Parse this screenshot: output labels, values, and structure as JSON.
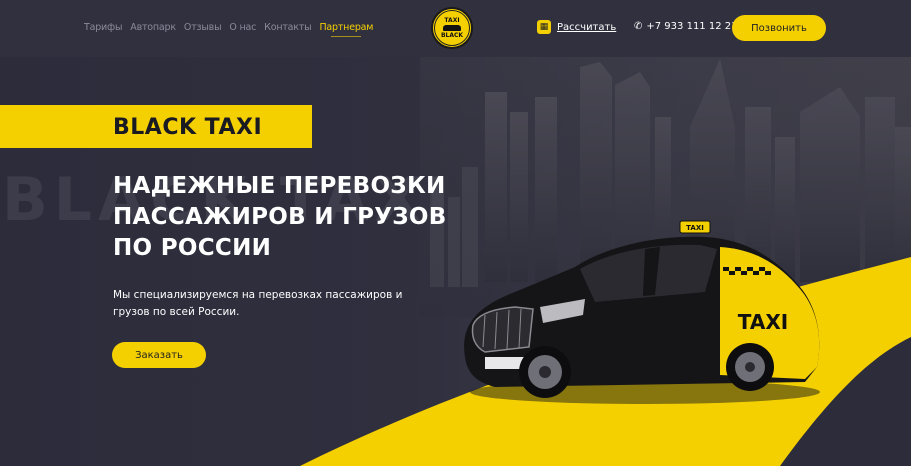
{
  "header": {
    "nav": [
      {
        "label": "Тарифы",
        "active": false
      },
      {
        "label": "Автопарк",
        "active": false
      },
      {
        "label": "Отзывы",
        "active": false
      },
      {
        "label": "О нас",
        "active": false
      },
      {
        "label": "Контакты",
        "active": false
      },
      {
        "label": "Партнерам",
        "active": true
      }
    ],
    "logo": {
      "top": "TAXI",
      "bottom": "BLACK"
    },
    "calc_label": "Рассчитать",
    "phone": "+7 933 111 12 21",
    "call_button": "Позвонить"
  },
  "hero": {
    "background_word": "BLACK TAXI",
    "brand": "BLACK TAXI",
    "headline_lines": [
      "НАДЕЖНЫЕ ПЕРЕВОЗКИ",
      "ПАССАЖИРОВ И ГРУЗОВ",
      "ПО РОССИИ"
    ],
    "subtext": "Мы специализируемся на перевозках пассажиров и грузов по всей России.",
    "order_button": "Заказать",
    "car_roof_sign": "TAXI",
    "car_door_text": "TAXI"
  },
  "colors": {
    "accent": "#f5d000",
    "header_bg": "#30303f",
    "hero_bg": "#2c2c3b"
  }
}
